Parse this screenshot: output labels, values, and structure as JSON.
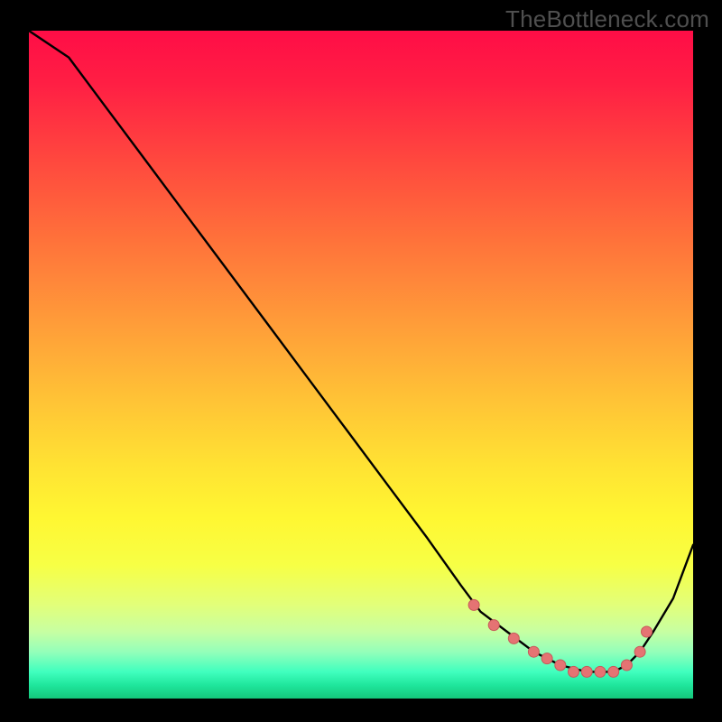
{
  "watermark": "TheBottleneck.com",
  "colors": {
    "background": "#000000",
    "curve_stroke": "#000000",
    "dot_fill": "#e57373",
    "dot_stroke": "#c75a5a"
  },
  "chart_data": {
    "type": "line",
    "title": "",
    "xlabel": "",
    "ylabel": "",
    "xlim": [
      0,
      100
    ],
    "ylim": [
      0,
      100
    ],
    "series": [
      {
        "name": "bottleneck-curve",
        "x": [
          0,
          6,
          12,
          18,
          24,
          30,
          36,
          42,
          48,
          54,
          60,
          65,
          68,
          72,
          76,
          80,
          84,
          88,
          90,
          92,
          94,
          97,
          100
        ],
        "y": [
          100,
          96,
          88,
          80,
          72,
          64,
          56,
          48,
          40,
          32,
          24,
          17,
          13,
          10,
          7,
          5,
          4,
          4,
          5,
          7,
          10,
          15,
          23
        ]
      }
    ],
    "markers": {
      "name": "trough-dots",
      "x": [
        67,
        70,
        73,
        76,
        78,
        80,
        82,
        84,
        86,
        88,
        90,
        92,
        93
      ],
      "y": [
        14,
        11,
        9,
        7,
        6,
        5,
        4,
        4,
        4,
        4,
        5,
        7,
        10
      ]
    }
  }
}
